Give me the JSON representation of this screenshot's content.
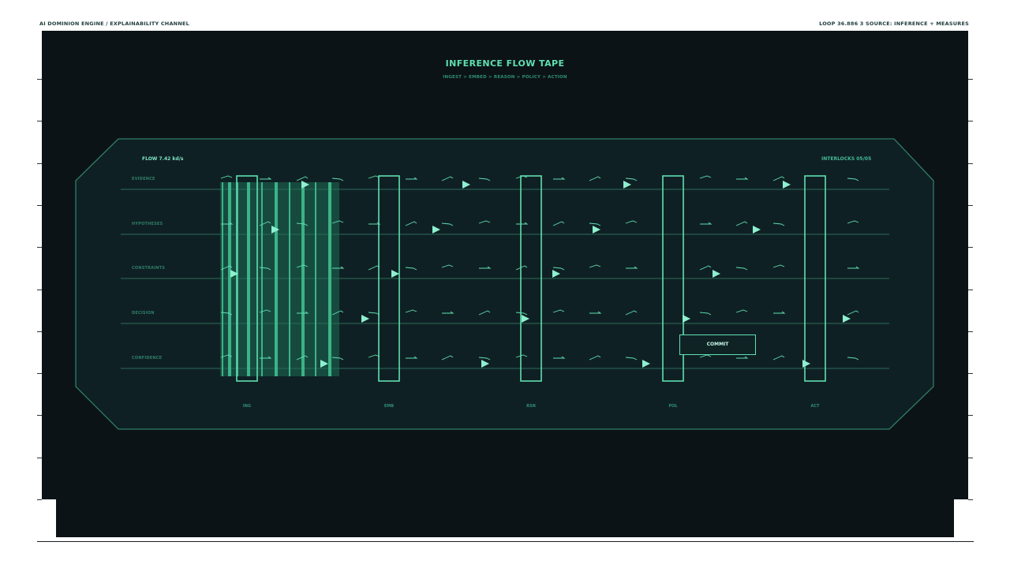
{
  "header": {
    "left": "AI DOMINION ENGINE / EXPLAINABILITY CHANNEL",
    "right": "LOOP 36.886 3 SOURCE: INFERENCE + MEASURES"
  },
  "title": "INFERENCE FLOW TAPE",
  "subtitle": "INGEST > EMBED > REASON > POLICY > ACTION",
  "flow": "FLOW 7.42 kd/s",
  "interlocks": "INTERLOCKS 05/05",
  "lanes": [
    "EVIDENCE",
    "HYPOTHESES",
    "CONSTRAINTS",
    "DECISION",
    "CONFIDENCE"
  ],
  "stages": [
    "ING",
    "EMB",
    "RSN",
    "POL",
    "ACT"
  ],
  "commit": "COMMIT",
  "colors": {
    "accent": "#5fe0b0",
    "panel": "#0f2024",
    "border": "#2f7d66",
    "background": "#0b1316"
  }
}
